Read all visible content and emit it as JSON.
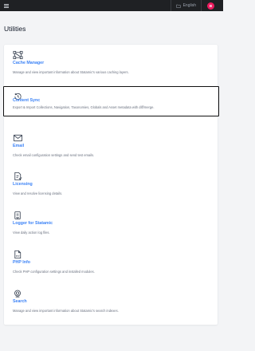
{
  "topbar": {
    "locale": "English",
    "avatar_initial": "B"
  },
  "page": {
    "title": "Utilities"
  },
  "utilities": [
    {
      "icon": "cache-icon",
      "title": "Cache Manager",
      "description": "Manage and view important information about Statamic's various caching layers."
    },
    {
      "icon": "sync-icon",
      "title": "Content Sync",
      "description": "Export & Import Collections, Navigation, Taxonomies, Globals and Asset metadata with diff/merge."
    },
    {
      "icon": "email-icon",
      "title": "Email",
      "description": "Check email configuration settings and send test emails."
    },
    {
      "icon": "license-icon",
      "title": "Licensing",
      "description": "View and resolve licensing details."
    },
    {
      "icon": "logger-icon",
      "title": "Logger for Statamic",
      "description": "View daily action log files."
    },
    {
      "icon": "php-file-icon",
      "title": "PHP Info",
      "description": "Check PHP configuration settings and installed modules."
    },
    {
      "icon": "search-icon",
      "title": "Search",
      "description": "Manage and view important information about Statamic's search indexes."
    }
  ]
}
